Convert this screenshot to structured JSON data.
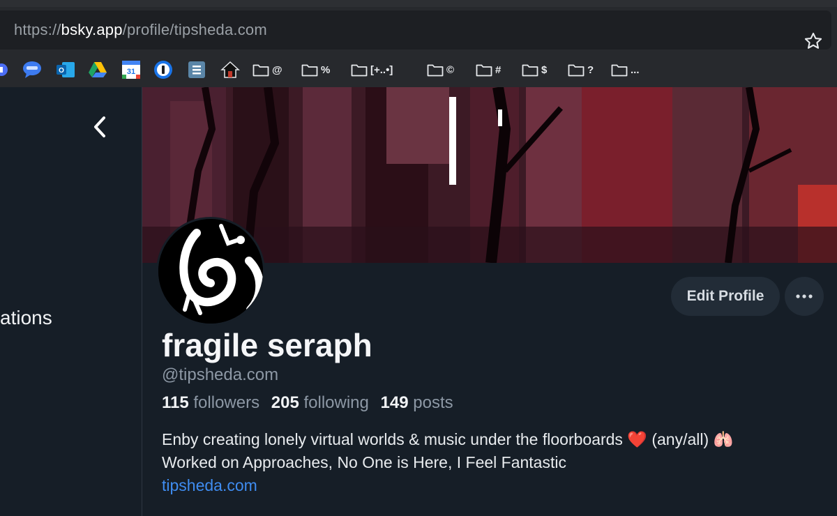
{
  "browser": {
    "url_scheme": "https://",
    "url_domain": "bsky.app",
    "url_path": "/profile/tipsheda.com",
    "bookmarks": [
      {
        "icon": "folder-icon",
        "label": "@"
      },
      {
        "icon": "folder-icon",
        "label": "%"
      },
      {
        "icon": "folder-icon",
        "label": "[+..•]"
      },
      {
        "icon": "folder-icon",
        "label": "©"
      },
      {
        "icon": "folder-icon",
        "label": "#"
      },
      {
        "icon": "folder-icon",
        "label": "$"
      },
      {
        "icon": "folder-icon",
        "label": "?"
      },
      {
        "icon": "folder-icon",
        "label": "..."
      }
    ],
    "app_icons": [
      "messages-icon",
      "outlook-icon",
      "google-drive-icon",
      "google-calendar-icon",
      "1password-icon",
      "tasks-icon",
      "home-icon"
    ],
    "calendar_day": "31"
  },
  "sidebar": {
    "nav_fragment": "ations"
  },
  "profile": {
    "display_name": "fragile seraph",
    "handle": "@tipsheda.com",
    "followers_count": "115",
    "followers_label": "followers",
    "following_count": "205",
    "following_label": "following",
    "posts_count": "149",
    "posts_label": "posts",
    "bio_line1": "Enby creating lonely virtual worlds & music under the floorboards ❤️ (any/all) 🫁",
    "bio_line2": "Worked on Approaches, No One is Here, I Feel Fantastic",
    "bio_link": "tipsheda.com",
    "edit_label": "Edit Profile"
  },
  "colors": {
    "background": "#161e27",
    "link": "#3f8cf0",
    "button_bg": "#222c37"
  }
}
